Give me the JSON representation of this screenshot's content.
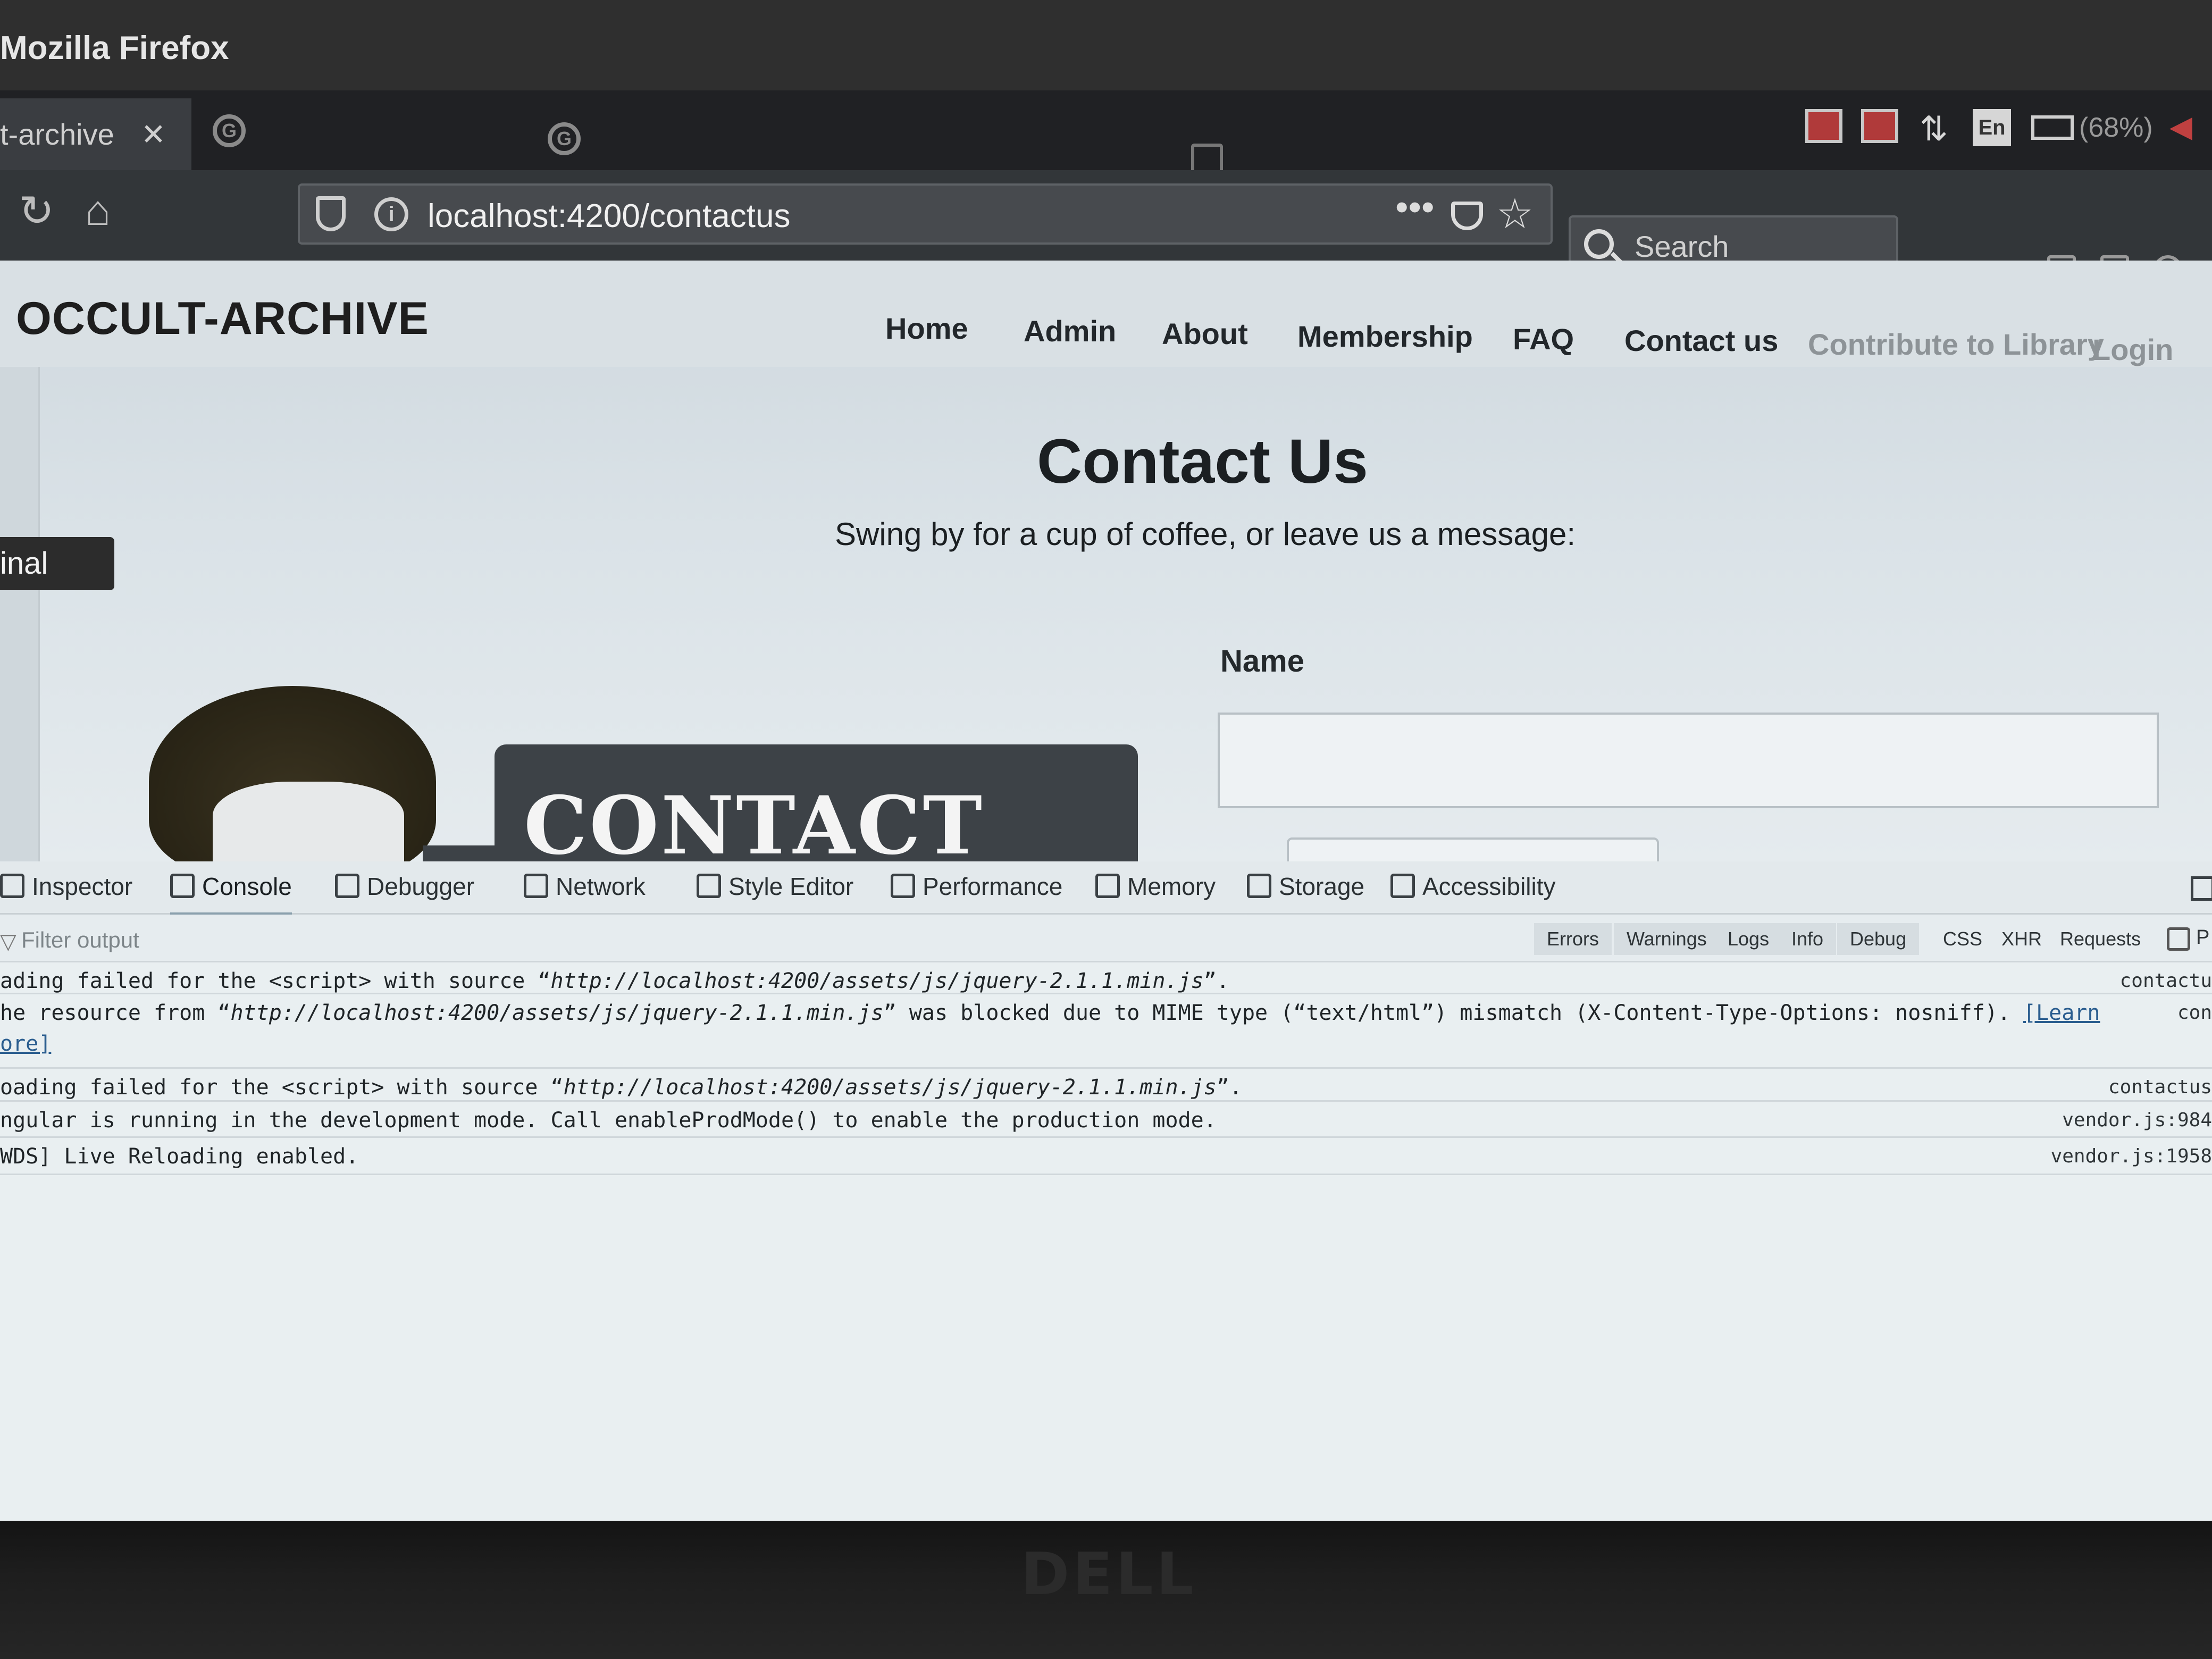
{
  "os": {
    "window_title": "Mozilla Firefox"
  },
  "browser": {
    "active_tab": {
      "label": "t-archive",
      "close": "✕"
    },
    "url": "localhost:4200/contactus",
    "search_placeholder": "Search",
    "menu_more": "•••",
    "bookmark": "☆",
    "reload": "↻",
    "home": "⌂"
  },
  "tray": {
    "language": "En",
    "battery": "(68%)",
    "arrows": "⇅"
  },
  "site": {
    "logo": "OCCULT-ARCHIVE",
    "nav": [
      {
        "label": "Home"
      },
      {
        "label": "Admin"
      },
      {
        "label": "About"
      },
      {
        "label": "Membership"
      },
      {
        "label": "FAQ"
      },
      {
        "label": "Contact us"
      },
      {
        "label": "Contribute to Library"
      },
      {
        "label": "Login"
      }
    ],
    "title": "Contact Us",
    "subtitle": "Swing by for a cup of coffee, or leave us a message:",
    "name_label": "Name",
    "banner": "CONTACT US!",
    "terminal_tooltip": "inal"
  },
  "devtools": {
    "tabs": [
      {
        "label": "Inspector"
      },
      {
        "label": "Console"
      },
      {
        "label": "Debugger"
      },
      {
        "label": "Network"
      },
      {
        "label": "Style Editor"
      },
      {
        "label": "Performance"
      },
      {
        "label": "Memory"
      },
      {
        "label": "Storage"
      },
      {
        "label": "Accessibility"
      }
    ],
    "filter_placeholder": "Filter output",
    "filters": [
      "Errors",
      "Warnings",
      "Logs",
      "Info",
      "Debug",
      "CSS",
      "XHR",
      "Requests"
    ],
    "persist_label": "P",
    "logs": [
      {
        "prefix": "ading failed for the <script> with source “",
        "url": "http://localhost:4200/assets/js/jquery-2.1.1.min.js",
        "suffix": "”.",
        "source": "contactu"
      },
      {
        "prefix": "he resource from “",
        "url": "http://localhost:4200/assets/js/jquery-2.1.1.min.js",
        "suffix": "” was blocked due to MIME type (“text/html”) mismatch (X-Content-Type-Options: nosniff).",
        "link": "[Learn",
        "link2": "ore]",
        "source": "con"
      },
      {
        "prefix": "oading failed for the <script> with source “",
        "url": "http://localhost:4200/assets/js/jquery-2.1.1.min.js",
        "suffix": "”.",
        "source": "contactus"
      },
      {
        "prefix": "ngular is running in the development mode. Call enableProdMode() to enable the production mode.",
        "source": "vendor.js:984"
      },
      {
        "prefix": "WDS] Live Reloading enabled.",
        "source": "vendor.js:1958"
      }
    ]
  },
  "bezel": {
    "brand": "DELL"
  }
}
